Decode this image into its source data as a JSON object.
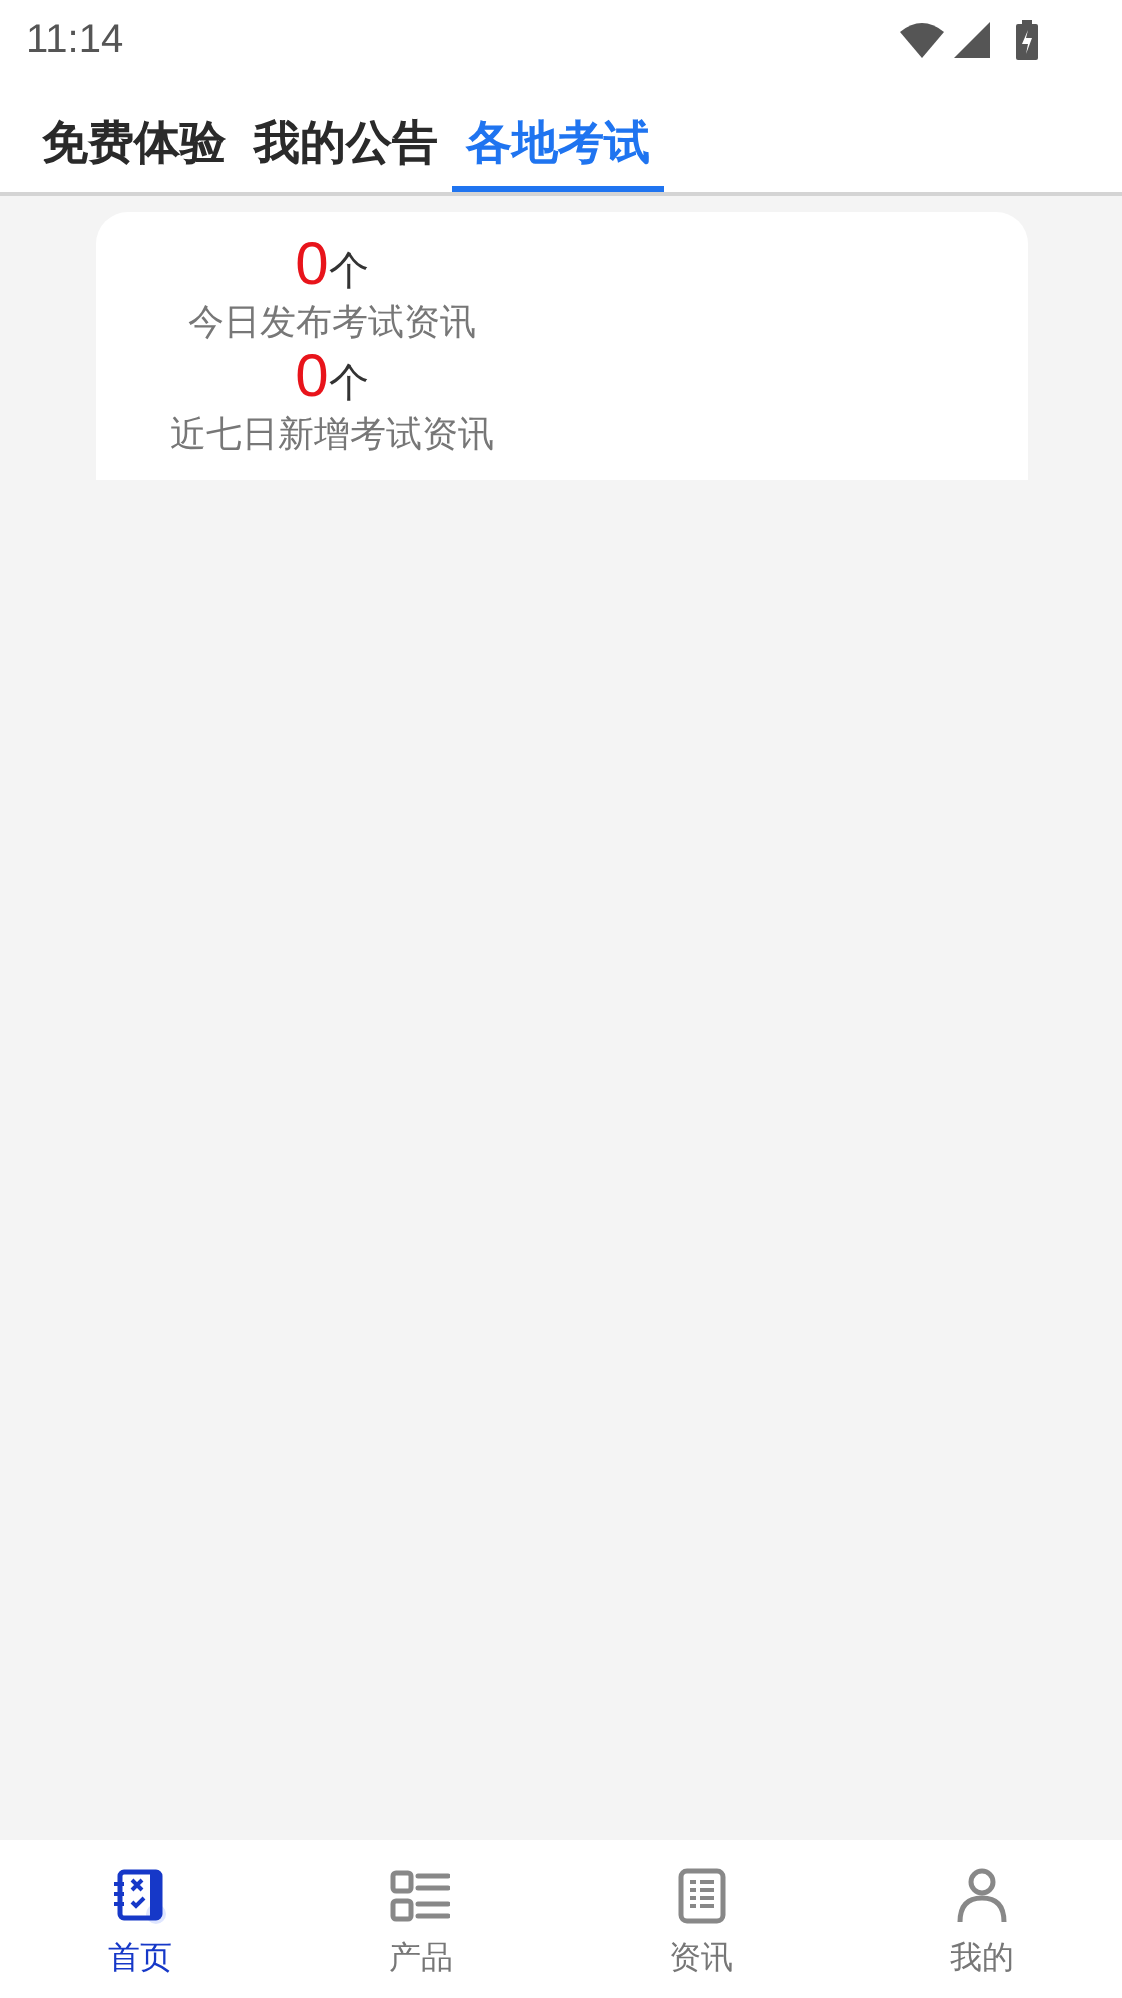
{
  "status_bar": {
    "time": "11:14"
  },
  "tabs": [
    {
      "label": "免费体验",
      "selected": false
    },
    {
      "label": "我的公告",
      "selected": false
    },
    {
      "label": "各地考试",
      "selected": true
    }
  ],
  "stats": [
    {
      "count": "0",
      "unit": "个",
      "label": "今日发布考试资讯"
    },
    {
      "count": "0",
      "unit": "个",
      "label": "近七日新增考试资讯"
    }
  ],
  "bottom_nav": [
    {
      "label": "首页",
      "selected": true
    },
    {
      "label": "产品",
      "selected": false
    },
    {
      "label": "资讯",
      "selected": false
    },
    {
      "label": "我的",
      "selected": false
    }
  ]
}
